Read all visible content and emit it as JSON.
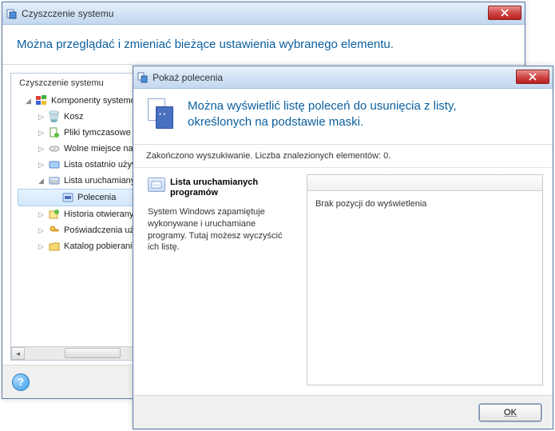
{
  "back_window": {
    "title": "Czyszczenie systemu",
    "info_banner": "Można przeglądać i zmieniać bieżące ustawienia wybranego elementu.",
    "tree_title": "Czyszczenie systemu",
    "tree": {
      "root": {
        "label": "Komponenty systemo"
      },
      "items": [
        {
          "label": "Kosz",
          "icon": "bin-icon"
        },
        {
          "label": "Pliki tymczasowe",
          "icon": "temp-icon"
        },
        {
          "label": "Wolne miejsce na",
          "icon": "disk-icon"
        },
        {
          "label": "Lista ostatnio używ",
          "icon": "recent-icon"
        },
        {
          "label": "Lista uruchamiany",
          "icon": "run-icon",
          "expanded": true,
          "children": [
            {
              "label": "Polecenia",
              "icon": "cmd-icon",
              "selected": true
            }
          ]
        },
        {
          "label": "Historia otwierany",
          "icon": "history-icon"
        },
        {
          "label": "Poświadczenia uży",
          "icon": "creds-icon"
        },
        {
          "label": "Katalog pobierania",
          "icon": "downloads-icon"
        }
      ]
    }
  },
  "front_window": {
    "title": "Pokaż polecenia",
    "header_line1": "Można wyświetlić listę poleceń do usunięcia z listy,",
    "header_line2": "określonych na podstawie maski.",
    "status": "Zakończono wyszukiwanie. Liczba znalezionych elementów: 0.",
    "section_title": "Lista uruchamianych programów",
    "section_desc": "System Windows zapamiętuje wykonywane i uruchamiane programy. Tutaj możesz wyczyścić ich listę.",
    "empty_msg": "Brak pozycji do wyświetlenia",
    "ok_label": "OK"
  }
}
